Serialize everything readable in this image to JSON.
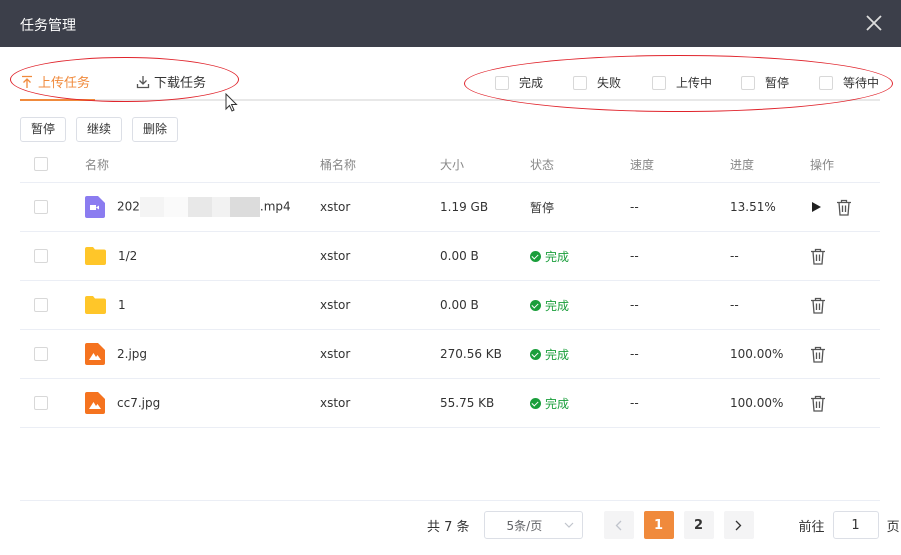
{
  "window": {
    "title": "任务管理"
  },
  "tabs": [
    {
      "label": "上传任务",
      "icon": "upload-icon",
      "active": true
    },
    {
      "label": "下载任务",
      "icon": "download-icon",
      "active": false
    }
  ],
  "filters": [
    {
      "label": "完成"
    },
    {
      "label": "失败"
    },
    {
      "label": "上传中"
    },
    {
      "label": "暂停"
    },
    {
      "label": "等待中"
    }
  ],
  "actions": {
    "pause": "暂停",
    "resume": "继续",
    "delete": "删除"
  },
  "table": {
    "headers": {
      "name": "名称",
      "bucket": "桶名称",
      "size": "大小",
      "status": "状态",
      "speed": "速度",
      "progress": "进度",
      "ops": "操作"
    },
    "rows": [
      {
        "name_prefix": "202",
        "name_suffix": ".mp4",
        "type": "video",
        "bucket": "xstor",
        "size": "1.19 GB",
        "status": "暂停",
        "speed": "--",
        "progress": "13.51%"
      },
      {
        "name": "1/2",
        "type": "folder",
        "bucket": "xstor",
        "size": "0.00 B",
        "status": "完成",
        "speed": "--",
        "progress": "--"
      },
      {
        "name": "1",
        "type": "folder",
        "bucket": "xstor",
        "size": "0.00 B",
        "status": "完成",
        "speed": "--",
        "progress": "--"
      },
      {
        "name": "2.jpg",
        "type": "image",
        "bucket": "xstor",
        "size": "270.56 KB",
        "status": "完成",
        "speed": "--",
        "progress": "100.00%"
      },
      {
        "name": "cc7.jpg",
        "type": "image",
        "bucket": "xstor",
        "size": "55.75 KB",
        "status": "完成",
        "speed": "--",
        "progress": "100.00%"
      }
    ]
  },
  "pagination": {
    "total": "共 7 条",
    "page_size": "5条/页",
    "pages": [
      "1",
      "2"
    ],
    "current": "1",
    "goto_label": "前往",
    "goto_value": "1",
    "goto_unit": "页"
  },
  "colors": {
    "accent": "#f08a3c",
    "titlebar": "#3c3f4a",
    "success": "#1a9e3b",
    "annotation": "#e0242c"
  }
}
